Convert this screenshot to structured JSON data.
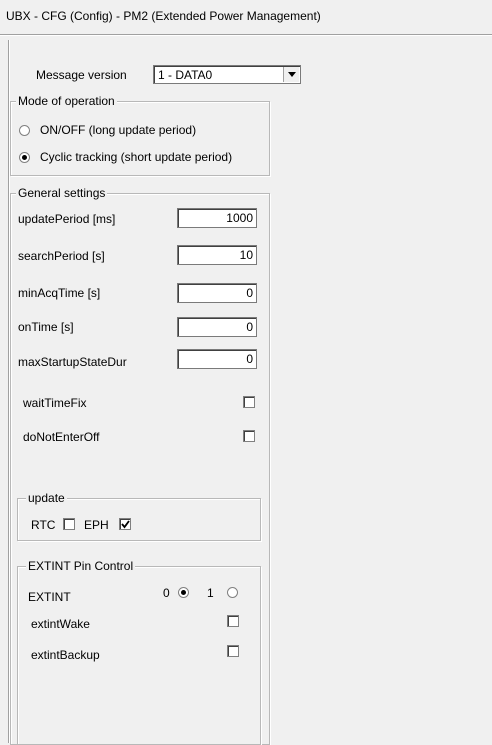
{
  "window": {
    "title": "UBX - CFG (Config) - PM2 (Extended Power Management)"
  },
  "message_version": {
    "label": "Message version",
    "selected": "1 - DATA0"
  },
  "mode": {
    "legend": "Mode of operation",
    "options": [
      {
        "label": "ON/OFF (long update period)",
        "selected": false
      },
      {
        "label": "Cyclic tracking (short update period)",
        "selected": true
      }
    ]
  },
  "general": {
    "legend": "General settings",
    "fields": [
      {
        "label": "updatePeriod [ms]",
        "value": "1000"
      },
      {
        "label": "searchPeriod [s]",
        "value": "10"
      },
      {
        "label": "minAcqTime [s]",
        "value": "0"
      },
      {
        "label": "onTime [s]",
        "value": "0"
      },
      {
        "label": "maxStartupStateDur",
        "value": "0"
      }
    ],
    "checks": [
      {
        "label": "waitTimeFix",
        "checked": false
      },
      {
        "label": "doNotEnterOff",
        "checked": false
      }
    ]
  },
  "update": {
    "legend": "update",
    "rtc_label": "RTC",
    "rtc_checked": false,
    "eph_label": "EPH",
    "eph_checked": true
  },
  "extint": {
    "legend": "EXTINT Pin Control",
    "label": "EXTINT",
    "opt0": "0",
    "opt1": "1",
    "selected": "0",
    "checks": [
      {
        "label": "extintWake",
        "checked": false
      },
      {
        "label": "extintBackup",
        "checked": false
      }
    ]
  }
}
